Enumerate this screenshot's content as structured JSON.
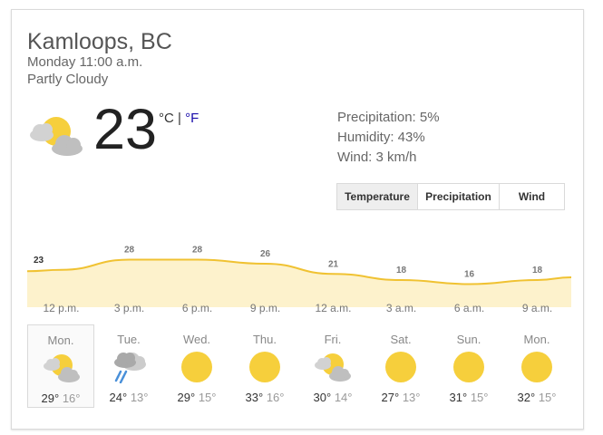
{
  "location": "Kamloops, BC",
  "datetime": "Monday 11:00 a.m.",
  "condition": "Partly Cloudy",
  "current": {
    "temp": "23",
    "unit_c": "°C",
    "separator": " | ",
    "unit_f": "°F",
    "icon": "partly-cloudy-icon"
  },
  "details": {
    "precipitation": "Precipitation: 5%",
    "humidity": "Humidity: 43%",
    "wind": "Wind: 3 km/h"
  },
  "tabs": [
    "Temperature",
    "Precipitation",
    "Wind"
  ],
  "selected_tab": "Temperature",
  "chart_data": {
    "type": "area",
    "x": [
      "12 p.m.",
      "3 p.m.",
      "6 p.m.",
      "9 p.m.",
      "12 a.m.",
      "3 a.m.",
      "6 a.m.",
      "9 a.m."
    ],
    "point_labels": [
      "23",
      "28",
      "28",
      "26",
      "21",
      "18",
      "16",
      "18"
    ],
    "values": [
      23,
      28,
      28,
      26,
      21,
      18,
      16,
      18
    ],
    "colors": {
      "fill": "#fdf2cc",
      "line": "#f0c232",
      "label": "#777777"
    }
  },
  "forecast": [
    {
      "day": "Mon.",
      "icon": "partly-cloudy-icon",
      "hi": "29°",
      "lo": "16°"
    },
    {
      "day": "Tue.",
      "icon": "rain-icon",
      "hi": "24°",
      "lo": "13°"
    },
    {
      "day": "Wed.",
      "icon": "sun-icon",
      "hi": "29°",
      "lo": "15°"
    },
    {
      "day": "Thu.",
      "icon": "sun-icon",
      "hi": "33°",
      "lo": "16°"
    },
    {
      "day": "Fri.",
      "icon": "partly-cloudy-icon",
      "hi": "30°",
      "lo": "14°"
    },
    {
      "day": "Sat.",
      "icon": "sun-icon",
      "hi": "27°",
      "lo": "13°"
    },
    {
      "day": "Sun.",
      "icon": "sun-icon",
      "hi": "31°",
      "lo": "15°"
    },
    {
      "day": "Mon.",
      "icon": "sun-icon",
      "hi": "32°",
      "lo": "15°"
    }
  ],
  "selected_day_index": 0
}
